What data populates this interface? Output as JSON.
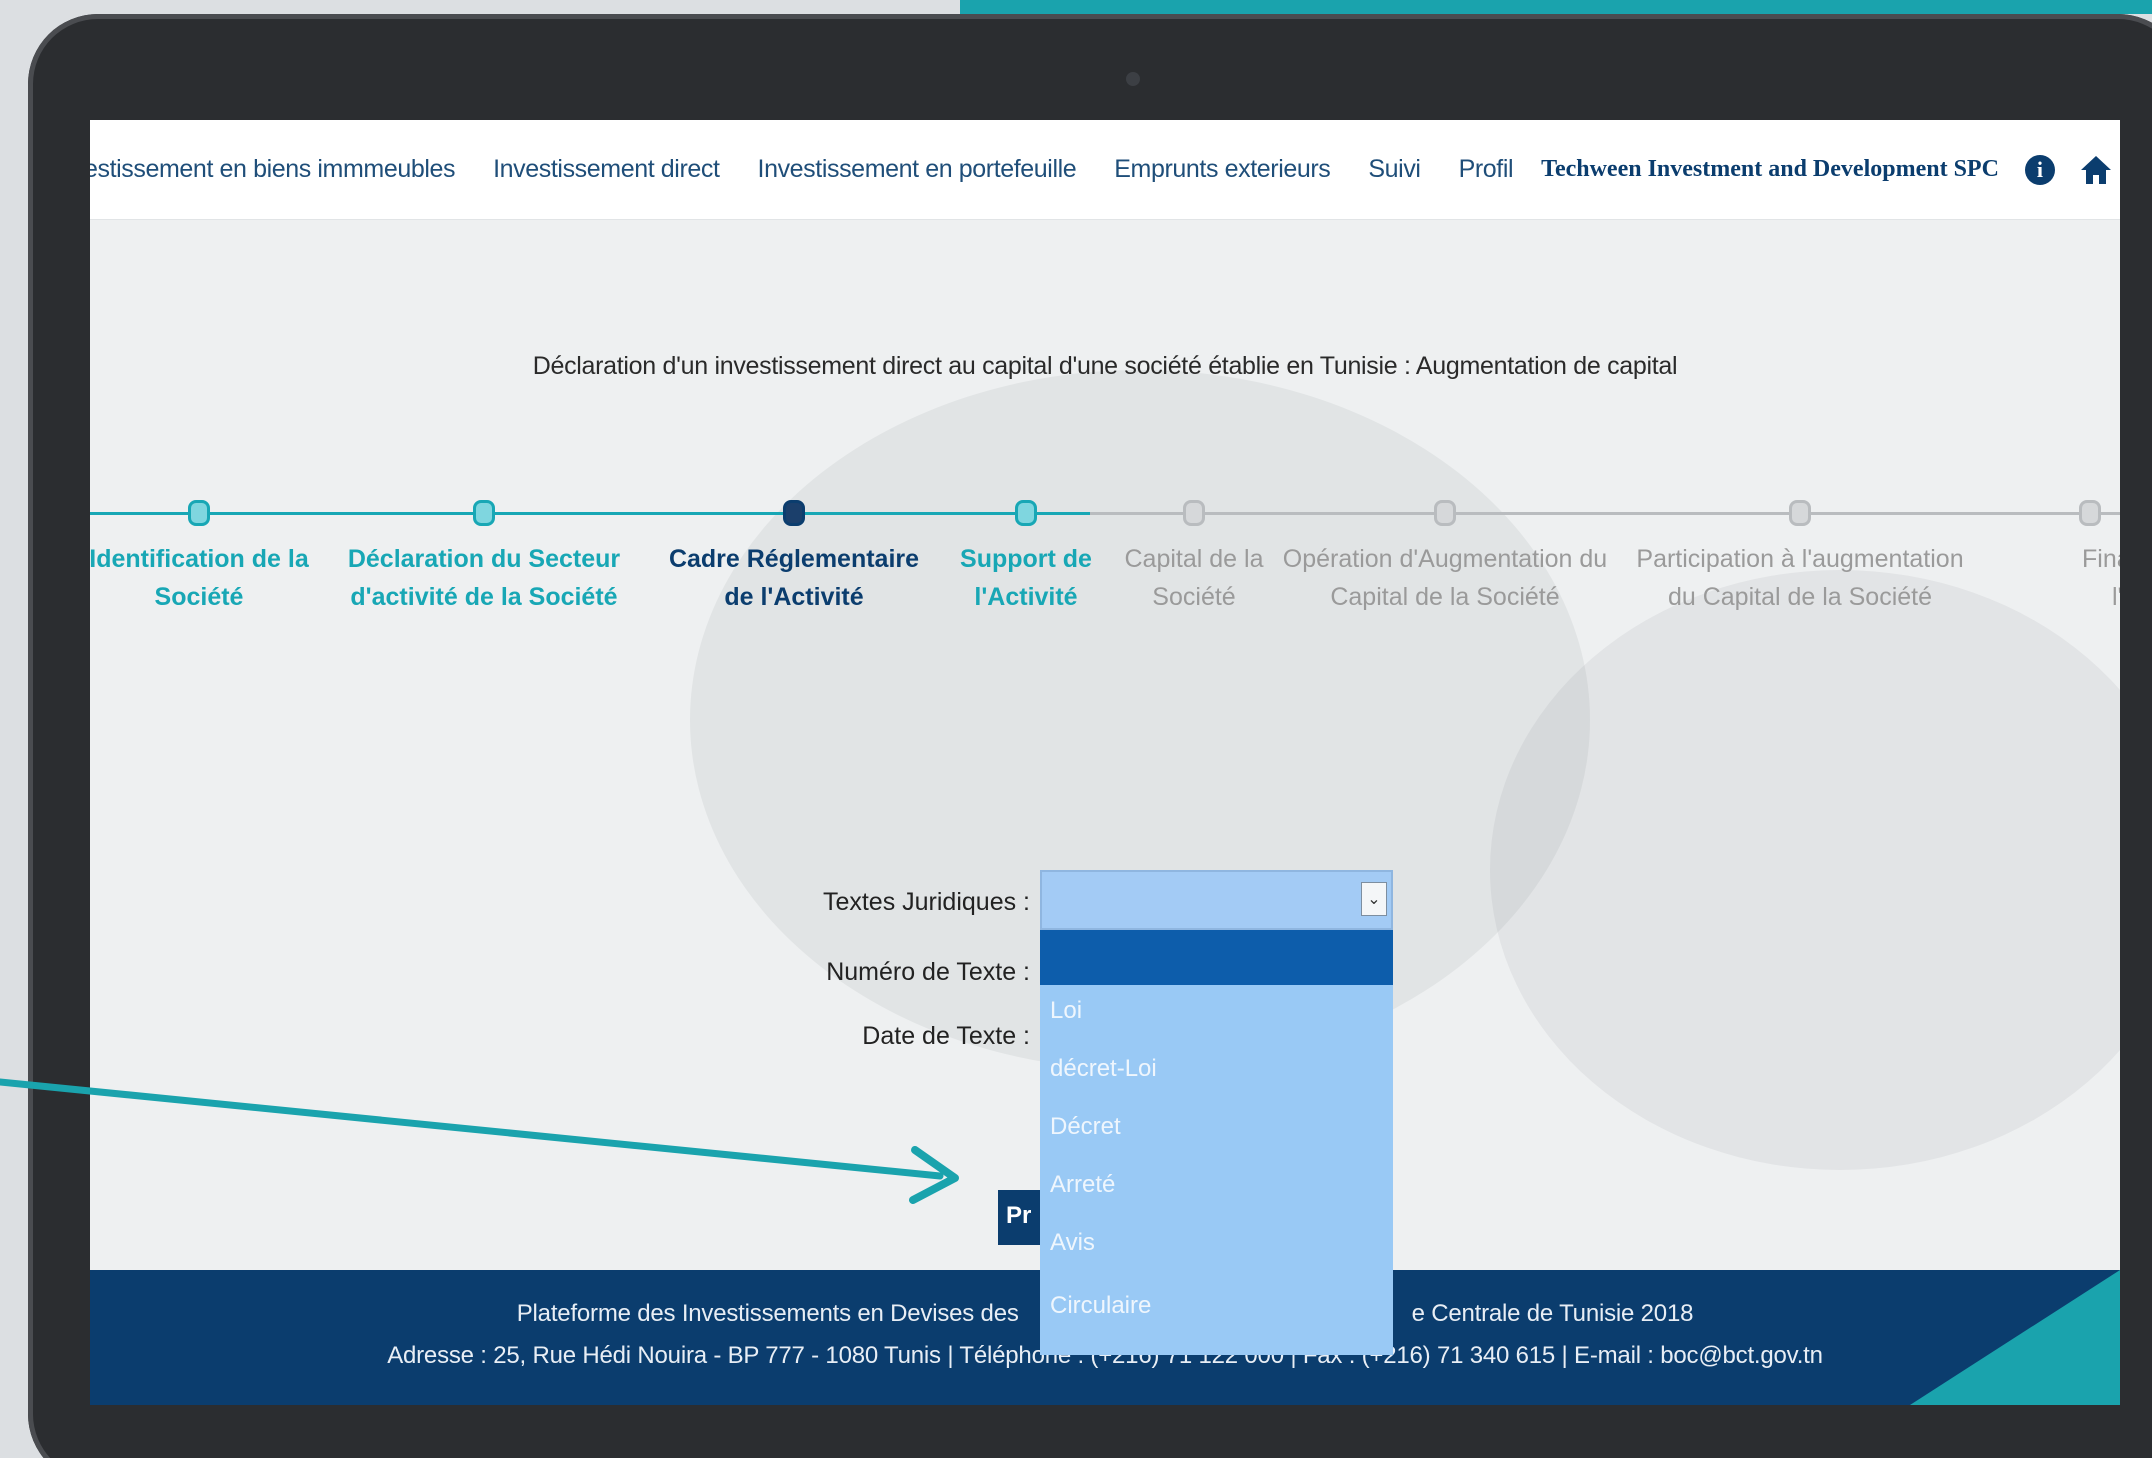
{
  "colors": {
    "primary_navy": "#0b3d6e",
    "accent_teal": "#1aa3ad",
    "step_done": "#18a7b5",
    "step_todo": "#9a9a9a",
    "dropdown_bg": "#99c9f5",
    "dropdown_selected": "#0d5dab"
  },
  "navbar": {
    "items": [
      "estissement en biens immmeubles",
      "Investissement direct",
      "Investissement en portefeuille",
      "Emprunts exterieurs",
      "Suivi",
      "Profil"
    ],
    "company": "Techween Investment and Development SPC",
    "info_icon": "info-icon",
    "home_icon": "home-icon"
  },
  "page": {
    "title": "Déclaration d'un investissement direct au capital d'une société établie en Tunisie : Augmentation de capital"
  },
  "stepper": {
    "steps": [
      {
        "line1": "Identification de la",
        "line2": "Société",
        "state": "done"
      },
      {
        "line1": "Déclaration du Secteur",
        "line2": "d'activité de la Société",
        "state": "done"
      },
      {
        "line1": "Cadre Réglementaire",
        "line2": "de l'Activité",
        "state": "active"
      },
      {
        "line1": "Support de",
        "line2": "l'Activité",
        "state": "done"
      },
      {
        "line1": "Capital de la",
        "line2": "Société",
        "state": "todo"
      },
      {
        "line1": "Opération d'Augmentation du",
        "line2": "Capital de la Société",
        "state": "todo"
      },
      {
        "line1": "Participation à l'augmentation",
        "line2": "du Capital de la Société",
        "state": "todo"
      },
      {
        "line1": "Financeme",
        "line2": "l'Opérati",
        "state": "todo"
      }
    ]
  },
  "form": {
    "textes_label": "Textes Juridiques :",
    "numero_label": "Numéro de Texte :",
    "date_label": "Date de Texte :",
    "selected_value": "",
    "options": [
      "Loi",
      "décret-Loi",
      "Décret",
      "Arreté",
      "Avis",
      "Circulaire"
    ],
    "prev_button_partial": "Pr"
  },
  "footer": {
    "line1": "Plateforme des Investissements en Devises des",
    "line1_tail": "e Centrale de Tunisie 2018",
    "line2": "Adresse : 25, Rue Hédi Nouira - BP 777 - 1080 Tunis | Téléphone : (+216) 71 122 000 | Fax : (+216) 71 340 615 | E-mail : boc@bct.gov.tn"
  }
}
